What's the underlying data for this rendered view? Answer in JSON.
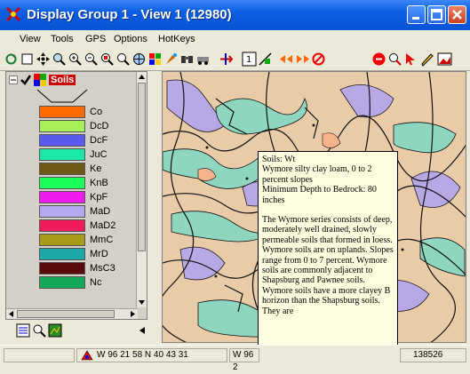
{
  "window": {
    "title": "Display Group 1 - View 1 (12980)"
  },
  "menu": [
    "View",
    "Tools",
    "GPS",
    "Options",
    "HotKeys"
  ],
  "legend": {
    "layer_name": "Soils",
    "items": [
      {
        "label": "Co",
        "color": "#ff6a00"
      },
      {
        "label": "DcD",
        "color": "#a8f05a"
      },
      {
        "label": "DcF",
        "color": "#5a5af0"
      },
      {
        "label": "JuC",
        "color": "#1ae8a8"
      },
      {
        "label": "Ke",
        "color": "#6e5a14"
      },
      {
        "label": "KnB",
        "color": "#1aff5a"
      },
      {
        "label": "KpF",
        "color": "#f01af0"
      },
      {
        "label": "MaD",
        "color": "#b4a8f0"
      },
      {
        "label": "MaD2",
        "color": "#f01a5a"
      },
      {
        "label": "MmC",
        "color": "#a89a14"
      },
      {
        "label": "MrD",
        "color": "#1aa8a8"
      },
      {
        "label": "MsC3",
        "color": "#5a0a0a"
      },
      {
        "label": "Nc",
        "color": "#14a85a"
      }
    ]
  },
  "tooltip": {
    "header": "Soils: Wt",
    "line1": "Wymore silty clay loam, 0 to 2 percent slopes",
    "line2": "Minimum Depth to Bedrock: 80 inches",
    "body": "The Wymore series consists of deep, moderately well drained, slowly permeable soils that formed in loess. Wymore soils are on uplands. Slopes range from 0 to 7 percent. Wymore soils are commonly adjacent to Shapsburg and Pawnee soils. Wymore soils have a more clayey B horizon than the Shapsburg soils. They are"
  },
  "status": {
    "coord1": "W 96 21 58  N 40 43 31",
    "coord2": "W 96 2",
    "scale": "138526"
  }
}
